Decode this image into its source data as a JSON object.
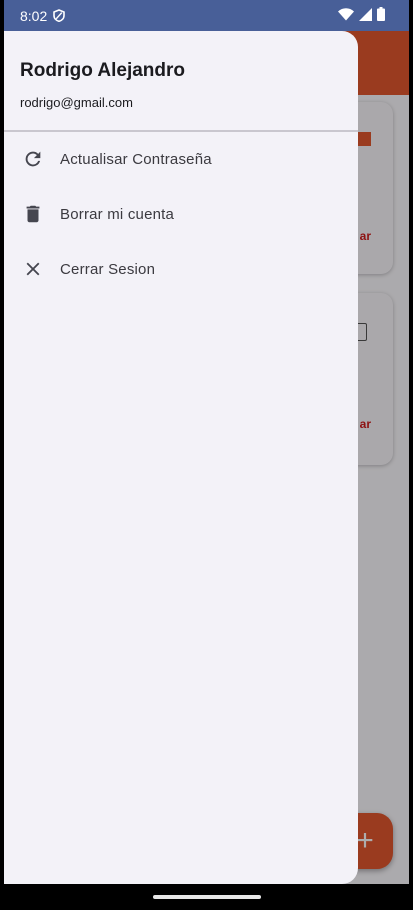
{
  "status_bar": {
    "time": "8:02",
    "icons": [
      "shield-icon",
      "wifi-icon",
      "signal-icon",
      "battery-icon"
    ]
  },
  "drawer": {
    "user_name": "Rodrigo Alejandro",
    "user_email": "rodrigo@gmail.com",
    "items": [
      {
        "label": "Actualisar Contraseña",
        "icon": "refresh-icon"
      },
      {
        "label": "Borrar mi cuenta",
        "icon": "trash-icon"
      },
      {
        "label": "Cerrar Sesion",
        "icon": "close-icon"
      }
    ]
  },
  "background": {
    "cards": [
      {
        "action_label": "ar"
      },
      {
        "action_label": "ar"
      }
    ],
    "fab_label": "+"
  },
  "colors": {
    "status_bar": "#485f98",
    "accent": "#e4572e",
    "drawer_bg": "#f3f2f8",
    "danger_text": "#d21d1d"
  }
}
